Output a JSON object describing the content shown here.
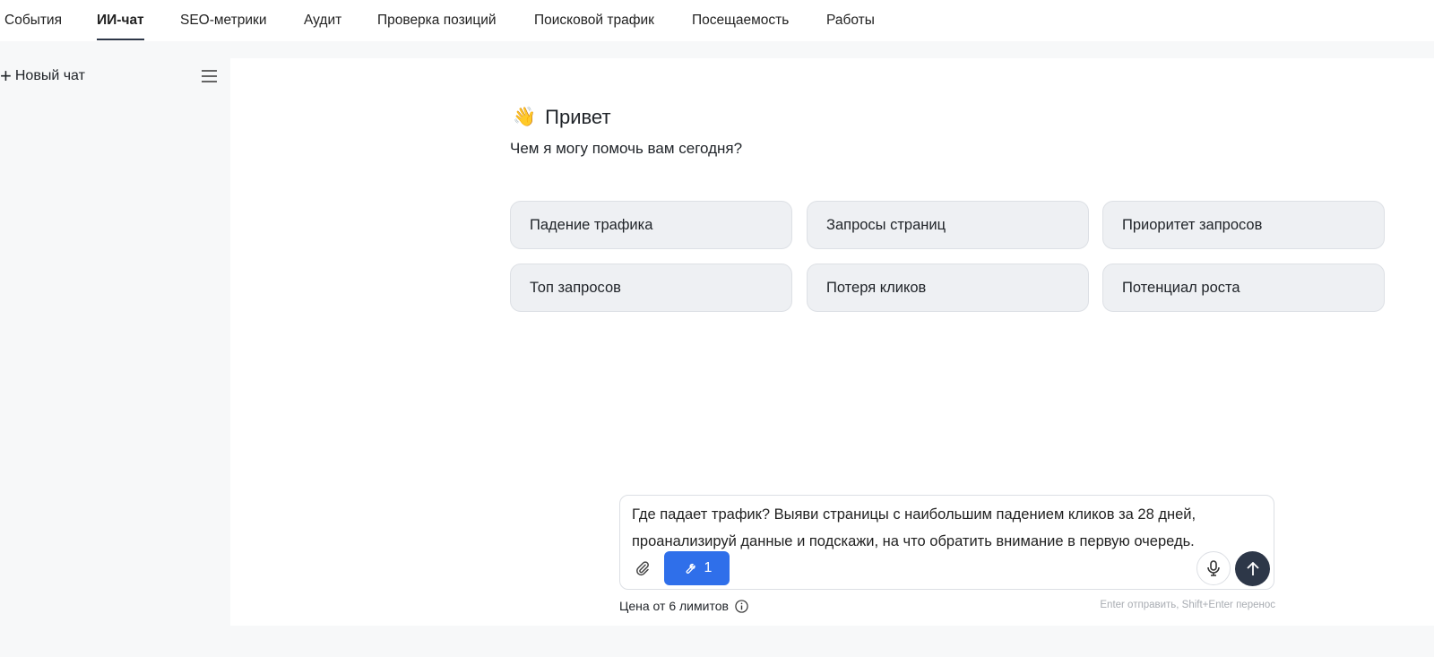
{
  "nav": {
    "tabs": [
      {
        "label": "События"
      },
      {
        "label": "ИИ-чат",
        "active": true
      },
      {
        "label": "SEO-метрики"
      },
      {
        "label": "Аудит"
      },
      {
        "label": "Проверка позиций"
      },
      {
        "label": "Поисковой трафик"
      },
      {
        "label": "Посещаемость"
      },
      {
        "label": "Работы"
      }
    ]
  },
  "sidebar": {
    "new_chat": "Новый чат",
    "plus": "+"
  },
  "greeting": {
    "emoji": "👋",
    "title": "Привет",
    "subtitle": "Чем я могу помочь вам сегодня?"
  },
  "suggestions": [
    "Падение трафика",
    "Запросы страниц",
    "Приоритет запросов",
    "Топ запросов",
    "Потеря кликов",
    "Потенциал роста"
  ],
  "composer": {
    "text": "Где падает трафик? Выяви страницы с наибольшим падением кликов за 28 дней, проанализируй данные и подскажи, на что обратить внимание в первую очередь.",
    "tools_count": "1",
    "price": "Цена от 6 лимитов",
    "hint": "Enter отправить, Shift+Enter перенос"
  },
  "colors": {
    "accent": "#2f6fea",
    "send": "#2d3748"
  }
}
